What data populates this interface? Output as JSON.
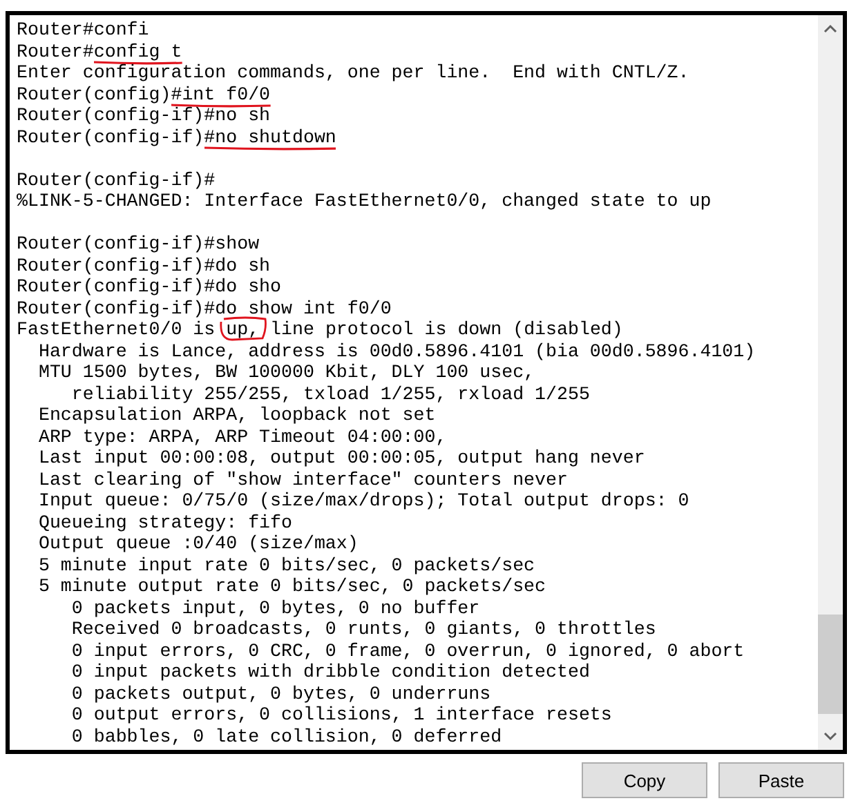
{
  "terminal": {
    "lines": [
      {
        "kind": "text",
        "parts": [
          {
            "text": "Router#confi"
          }
        ]
      },
      {
        "kind": "text",
        "parts": [
          {
            "text": "Router#"
          },
          {
            "text": "config t",
            "underlined": true
          }
        ]
      },
      {
        "kind": "text",
        "parts": [
          {
            "text": "Enter configuration commands, one per line.  End with CNTL/Z."
          }
        ]
      },
      {
        "kind": "text",
        "parts": [
          {
            "text": "Router(config)"
          },
          {
            "text": "#int f0/0",
            "underlined": true
          }
        ]
      },
      {
        "kind": "text",
        "parts": [
          {
            "text": "Router(config-if)#no sh"
          }
        ]
      },
      {
        "kind": "text",
        "parts": [
          {
            "text": "Router(config-if)"
          },
          {
            "text": "#no shutdown",
            "underlined": true
          }
        ]
      },
      {
        "kind": "blank"
      },
      {
        "kind": "text",
        "parts": [
          {
            "text": "Router(config-if)#"
          }
        ]
      },
      {
        "kind": "text",
        "parts": [
          {
            "text": "%LINK-5-CHANGED: Interface FastEthernet0/0, changed state to up"
          }
        ]
      },
      {
        "kind": "blank"
      },
      {
        "kind": "text",
        "parts": [
          {
            "text": "Router(config-if)#show"
          }
        ]
      },
      {
        "kind": "text",
        "parts": [
          {
            "text": "Router(config-if)#do sh"
          }
        ]
      },
      {
        "kind": "text",
        "parts": [
          {
            "text": "Router(config-if)#do sho"
          }
        ]
      },
      {
        "kind": "text",
        "parts": [
          {
            "text": "Router(config-if)#do show int f0/0"
          }
        ]
      },
      {
        "kind": "text",
        "parts": [
          {
            "text": "FastEthernet0/0 is "
          },
          {
            "text": "up,",
            "circled": true
          },
          {
            "text": " line protocol is down (disabled)"
          }
        ]
      },
      {
        "kind": "text",
        "parts": [
          {
            "text": "  Hardware is Lance, address is 00d0.5896.4101 (bia 00d0.5896.4101)"
          }
        ]
      },
      {
        "kind": "text",
        "parts": [
          {
            "text": "  MTU 1500 bytes, BW 100000 Kbit, DLY 100 usec,"
          }
        ]
      },
      {
        "kind": "text",
        "parts": [
          {
            "text": "     reliability 255/255, txload 1/255, rxload 1/255"
          }
        ]
      },
      {
        "kind": "text",
        "parts": [
          {
            "text": "  Encapsulation ARPA, loopback not set"
          }
        ]
      },
      {
        "kind": "text",
        "parts": [
          {
            "text": "  ARP type: ARPA, ARP Timeout 04:00:00,"
          }
        ]
      },
      {
        "kind": "text",
        "parts": [
          {
            "text": "  Last input 00:00:08, output 00:00:05, output hang never"
          }
        ]
      },
      {
        "kind": "text",
        "parts": [
          {
            "text": "  Last clearing of \"show interface\" counters never"
          }
        ]
      },
      {
        "kind": "text",
        "parts": [
          {
            "text": "  Input queue: 0/75/0 (size/max/drops); Total output drops: 0"
          }
        ]
      },
      {
        "kind": "text",
        "parts": [
          {
            "text": "  Queueing strategy: fifo"
          }
        ]
      },
      {
        "kind": "text",
        "parts": [
          {
            "text": "  Output queue :0/40 (size/max)"
          }
        ]
      },
      {
        "kind": "text",
        "parts": [
          {
            "text": "  5 minute input rate 0 bits/sec, 0 packets/sec"
          }
        ]
      },
      {
        "kind": "text",
        "parts": [
          {
            "text": "  5 minute output rate 0 bits/sec, 0 packets/sec"
          }
        ]
      },
      {
        "kind": "text",
        "parts": [
          {
            "text": "     0 packets input, 0 bytes, 0 no buffer"
          }
        ]
      },
      {
        "kind": "text",
        "parts": [
          {
            "text": "     Received 0 broadcasts, 0 runts, 0 giants, 0 throttles"
          }
        ]
      },
      {
        "kind": "text",
        "parts": [
          {
            "text": "     0 input errors, 0 CRC, 0 frame, 0 overrun, 0 ignored, 0 abort"
          }
        ]
      },
      {
        "kind": "text",
        "parts": [
          {
            "text": "     0 input packets with dribble condition detected"
          }
        ]
      },
      {
        "kind": "text",
        "parts": [
          {
            "text": "     0 packets output, 0 bytes, 0 underruns"
          }
        ]
      },
      {
        "kind": "text",
        "parts": [
          {
            "text": "     0 output errors, 0 collisions, 1 interface resets"
          }
        ]
      },
      {
        "kind": "text",
        "parts": [
          {
            "text": "     0 babbles, 0 late collision, 0 deferred"
          }
        ]
      }
    ]
  },
  "buttons": [
    "Copy",
    "Paste"
  ]
}
